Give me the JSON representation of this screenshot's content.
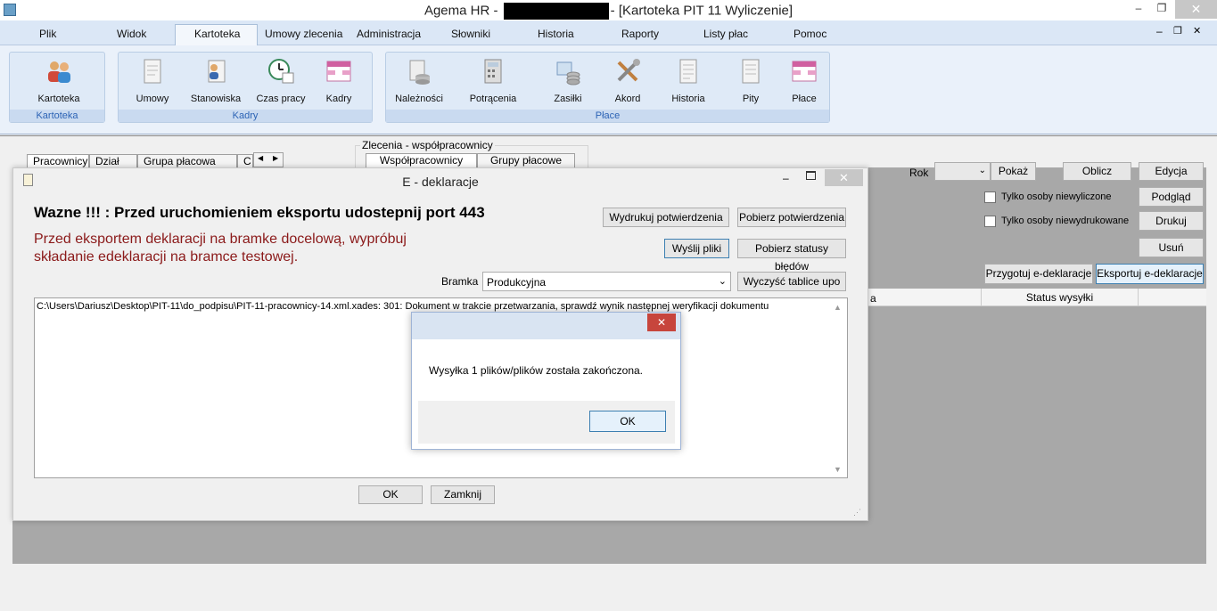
{
  "window": {
    "title_left": "Agema HR -",
    "title_right": "- [Kartoteka PIT 11 Wyliczenie]",
    "minimize": "–",
    "maximize": "❐",
    "close": "✕"
  },
  "menu": {
    "items": [
      "Plik",
      "Widok",
      "Kartoteka",
      "Umowy zlecenia",
      "Administracja",
      "Słowniki",
      "Historia",
      "Raporty",
      "Listy płac",
      "Pomoc"
    ],
    "active": "Kartoteka",
    "mdi_min": "–",
    "mdi_restore": "❐",
    "mdi_close": "✕"
  },
  "ribbon": {
    "groups": [
      {
        "label": "Kartoteka",
        "buttons": [
          {
            "label": "Kartoteka",
            "icon": "people-icon"
          }
        ]
      },
      {
        "label": "Kadry",
        "buttons": [
          {
            "label": "Umowy",
            "icon": "document-icon"
          },
          {
            "label": "Stanowiska",
            "icon": "person-document-icon"
          },
          {
            "label": "Czas pracy",
            "icon": "clock-calendar-icon"
          },
          {
            "label": "Kadry",
            "icon": "grid-icon"
          }
        ]
      },
      {
        "label": "Płace",
        "buttons": [
          {
            "label": "Należności",
            "icon": "database-icon"
          },
          {
            "label": "Potrącenia",
            "icon": "calculator-icon"
          },
          {
            "label": "Zasiłki",
            "icon": "coins-icon"
          },
          {
            "label": "Akord",
            "icon": "tools-icon"
          },
          {
            "label": "Historia",
            "icon": "page-icon"
          },
          {
            "label": "Pity",
            "icon": "page-icon"
          },
          {
            "label": "Płace",
            "icon": "grid-icon"
          }
        ]
      }
    ]
  },
  "left_tabs": [
    "Pracownicy",
    "Dział",
    "Grupa płacowa",
    "C"
  ],
  "zlecenia": {
    "caption": "Zlecenia - współpracownicy",
    "tabs": [
      "Współpracownicy",
      "Grupy płacowe"
    ]
  },
  "right_panel": {
    "rok_label": "Rok",
    "rok_value": "",
    "pokaz": "Pokaż",
    "oblicz": "Oblicz",
    "edycja": "Edycja",
    "only_uncalculated": "Tylko osoby niewyliczone",
    "only_unprinted": "Tylko osoby niewydrukowane",
    "podglad": "Podgląd",
    "drukuj": "Drukuj",
    "usun": "Usuń",
    "przygotuj": "Przygotuj e-deklaracje",
    "eksportuj": "Eksportuj e-deklaracje",
    "col_partial": "a",
    "col_status": "Status wysyłki"
  },
  "dialog": {
    "title": "E - deklaracje",
    "warning": "Wazne !!! : Przed uruchomieniem eksportu udostepnij port 443",
    "note_line1": "Przed eksportem deklaracji na bramke docelową, wypróbuj",
    "note_line2": "składanie edeklaracji na bramce testowej.",
    "btn_print_confirm": "Wydrukuj potwierdzenia",
    "btn_get_confirm": "Pobierz potwierdzenia",
    "btn_send": "Wyślij pliki",
    "btn_get_errors": "Pobierz statusy błędów",
    "bramka_label": "Bramka",
    "bramka_value": "Produkcyjna",
    "btn_clear_upo": "Wyczyść tablice upo",
    "log_line": "C:\\Users\\Dariusz\\Desktop\\PIT-11\\do_podpisu\\PIT-11-pracownicy-14.xml.xades: 301: Dokument w trakcie przetwarzania, sprawdź wynik następnej weryfikacji dokumentu",
    "ok": "OK",
    "close": "Zamknij"
  },
  "message_box": {
    "text": "Wysyłka 1 plików/plików została zakończona.",
    "ok": "OK"
  },
  "colors": {
    "ribbon_group_label": "#2c63b5",
    "note_text": "#8b1a1a",
    "close_red": "#c7453c"
  }
}
